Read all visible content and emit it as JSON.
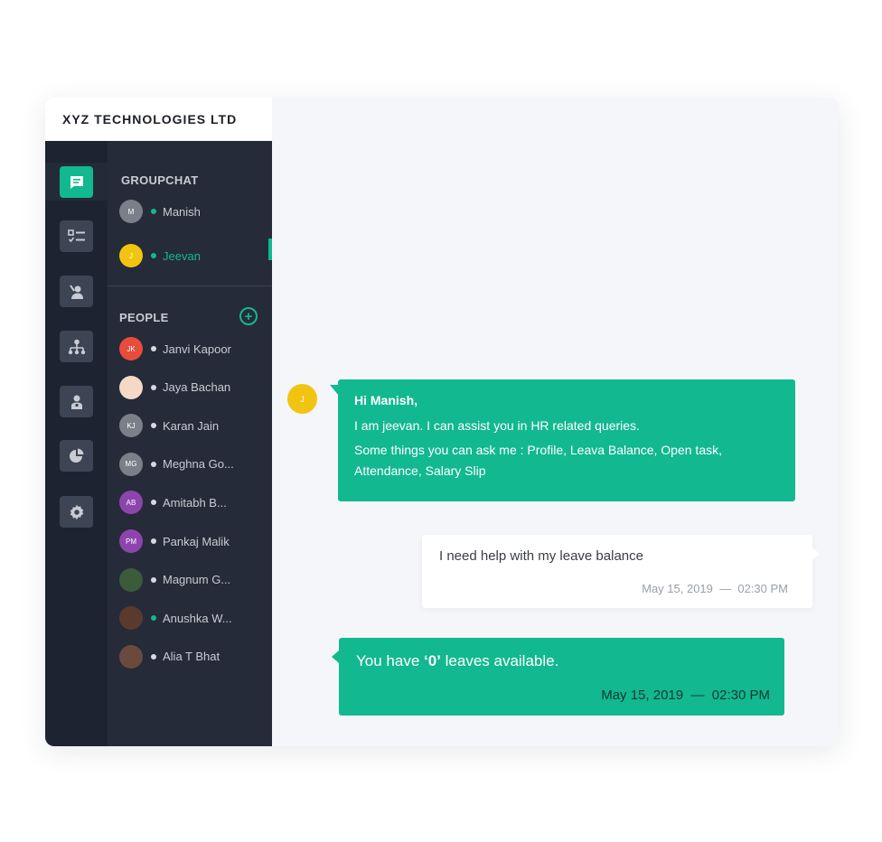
{
  "company": {
    "name": "XYZ TECHNOLOGIES LTD"
  },
  "rail": {
    "items": [
      {
        "icon": "chat-icon",
        "active": true
      },
      {
        "icon": "task-list-icon",
        "active": false
      },
      {
        "icon": "user-profile-icon",
        "active": false
      },
      {
        "icon": "org-chart-icon",
        "active": false
      },
      {
        "icon": "employee-icon",
        "active": false
      },
      {
        "icon": "pie-chart-icon",
        "active": false
      },
      {
        "icon": "settings-icon",
        "active": false
      }
    ]
  },
  "groupchat": {
    "title": "GROUPCHAT",
    "members": [
      {
        "initials": "M",
        "name": "Manish",
        "avatar_color": "#7a7f89",
        "status_color": "#12b890",
        "active": false
      },
      {
        "initials": "J",
        "name": "Jeevan",
        "avatar_color": "#f1c40f",
        "status_color": "#12b890",
        "active": true
      }
    ]
  },
  "people": {
    "title": "PEOPLE",
    "add_icon": "plus-circle-icon",
    "list": [
      {
        "initials": "JK",
        "name": "Janvi Kapoor",
        "avatar_color": "#e74c3c",
        "status_color": "#d7d9de"
      },
      {
        "initials": "",
        "name": "Jaya Bachan",
        "avatar_color": "#f4d9c6",
        "status_color": "#d7d9de",
        "photo": true
      },
      {
        "initials": "KJ",
        "name": "Karan Jain",
        "avatar_color": "#7a7f89",
        "status_color": "#d7d9de"
      },
      {
        "initials": "MG",
        "name": "Meghna Go...",
        "avatar_color": "#7a7f89",
        "status_color": "#d7d9de"
      },
      {
        "initials": "AB",
        "name": "Amitabh B...",
        "avatar_color": "#8e44ad",
        "status_color": "#d7d9de"
      },
      {
        "initials": "PM",
        "name": "Pankaj Malik",
        "avatar_color": "#8e44ad",
        "status_color": "#d7d9de"
      },
      {
        "initials": "",
        "name": "Magnum G...",
        "avatar_color": "#3b5b3b",
        "status_color": "#d7d9de",
        "photo": true
      },
      {
        "initials": "",
        "name": "Anushka W...",
        "avatar_color": "#5b3a2e",
        "status_color": "#12b890",
        "photo": true
      },
      {
        "initials": "",
        "name": "Alia T Bhat",
        "avatar_color": "#6b4a3e",
        "status_color": "#d7d9de",
        "photo": true
      }
    ]
  },
  "chat": {
    "bot_avatar_initial": "J",
    "bot_message": {
      "greeting": "Hi Manish,",
      "line1": "I am jeevan. I can assist you in HR related queries.",
      "line2": "Some things you can ask me : Profile, Leava Balance, Open task, Attendance, Salary Slip"
    },
    "user_message": {
      "text": "I need help with my leave balance",
      "date": "May 15, 2019",
      "time": "02:30 PM"
    },
    "bot_reply": {
      "prefix": "You have ",
      "highlight": "‘0’",
      "suffix": " leaves available.",
      "date": "May 15, 2019",
      "time": "02:30 PM"
    }
  },
  "colors": {
    "accent": "#12b890",
    "sidebar_rail": "#1d2330",
    "sidebar_panel": "#252b38",
    "chat_bg": "#f5f6fa"
  }
}
